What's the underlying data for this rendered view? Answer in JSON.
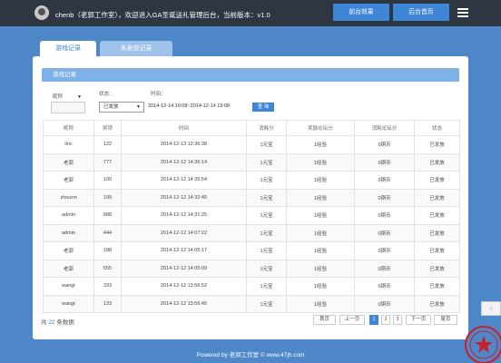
{
  "header": {
    "welcome": "chenb（老郭工作室），欢迎进入GA圣诞送礼管理后台，当前版本：v1.0",
    "front_btn": "前台效果",
    "home_btn": "后台首页"
  },
  "tabs": [
    "游戏记录",
    "未发放记录"
  ],
  "panel": {
    "title": "游戏记录",
    "filters": {
      "name_label": "昵称",
      "status_label": "状态：",
      "time_label": "时间：",
      "status_value": "已发放",
      "date_range": "2014-12-14 19:08~2014-12-14 19:08",
      "query_btn": "查 询"
    },
    "columns": [
      "昵称",
      "奖项",
      "时间",
      "消耗分",
      "奖励论坛分",
      "消耗论坛分",
      "状态"
    ],
    "rows": [
      [
        "linc",
        "122",
        "2014-12-13 12:36:38",
        "1元宝",
        "1经验",
        "0铜币",
        "已发放"
      ],
      [
        "老郭",
        "777",
        "2014-12-12 14:36:14",
        "1元宝",
        "1经验",
        "0铜币",
        "已发放"
      ],
      [
        "老郭",
        "100",
        "2014-12-12 14:35:54",
        "1元宝",
        "1经验",
        "0铜币",
        "已发放"
      ],
      [
        "zhourm",
        "199",
        "2014-12-12 14:32:45",
        "1元宝",
        "1经验",
        "0铜币",
        "已发放"
      ],
      [
        "admin",
        "888",
        "2014-12-12 14:31:25",
        "1元宝",
        "1经验",
        "0铜币",
        "已发放"
      ],
      [
        "admin",
        "444",
        "2014-12-12 14:07:22",
        "1元宝",
        "1经验",
        "0铜币",
        "已发放"
      ],
      [
        "老郭",
        "188",
        "2014-12-12 14:05:17",
        "1元宝",
        "1经验",
        "0铜币",
        "已发放"
      ],
      [
        "老郭",
        "555",
        "2014-12-12 14:05:09",
        "1元宝",
        "1经验",
        "0铜币",
        "已发放"
      ],
      [
        "wangt",
        "333",
        "2014-12-12 13:56:52",
        "1元宝",
        "1经验",
        "0铜币",
        "已发放"
      ],
      [
        "wangt",
        "133",
        "2014-12-12 13:56:45",
        "1元宝",
        "1经验",
        "0铜币",
        "已发放"
      ]
    ],
    "total_prefix": "共",
    "total_count": "22",
    "total_suffix": "条数据",
    "pager": {
      "first": "首页",
      "prev": "上一页",
      "pages": [
        "1",
        "2",
        "3"
      ],
      "next": "下一页",
      "last": "尾页"
    }
  },
  "footer": "Powered by 老郭工作室 © www.47jh.com",
  "side_tab": "⌂",
  "colors": {
    "accent": "#3d86d8",
    "topbar": "#2d3641",
    "background": "#4e88c9"
  }
}
